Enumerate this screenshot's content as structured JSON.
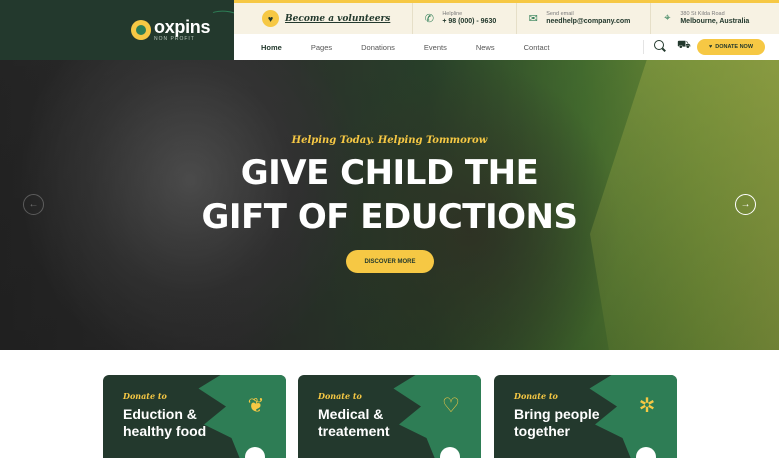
{
  "brand": {
    "name": "oxpins",
    "tagline": "NON PROFIT"
  },
  "info_bar": {
    "volunteer_text": "Become a volunteers",
    "helpline_label": "Helpline",
    "helpline_value": "+ 98 (000) - 9630",
    "email_label": "Send email",
    "email_value": "needhelp@company.com",
    "address_line1": "380 St Kilda Road",
    "address_line2": "Melbourne, Australia"
  },
  "nav": {
    "items": [
      {
        "label": "Home",
        "active": true
      },
      {
        "label": "Pages",
        "active": false
      },
      {
        "label": "Donations",
        "active": false
      },
      {
        "label": "Events",
        "active": false
      },
      {
        "label": "News",
        "active": false
      },
      {
        "label": "Contact",
        "active": false
      }
    ],
    "donate_label": "DONATE NOW"
  },
  "hero": {
    "tagline": "Helping Today. Helping Tommorow",
    "title_line1": "GIVE CHILD THE",
    "title_line2": "GIFT OF EDUCTIONS",
    "cta_label": "DISCOVER MORE"
  },
  "cards": [
    {
      "kicker": "Donate to",
      "title_line1": "Eduction &",
      "title_line2": "healthy food",
      "icon": "apple-books-icon"
    },
    {
      "kicker": "Donate to",
      "title_line1": "Medical &",
      "title_line2": "treatement",
      "icon": "heart-hand-icon"
    },
    {
      "kicker": "Donate to",
      "title_line1": "Bring people",
      "title_line2": "together",
      "icon": "people-together-icon"
    }
  ],
  "colors": {
    "brand_dark": "#23392d",
    "brand_green": "#2e7d55",
    "accent_yellow": "#f6c844",
    "info_bg": "#f7f2e3"
  }
}
